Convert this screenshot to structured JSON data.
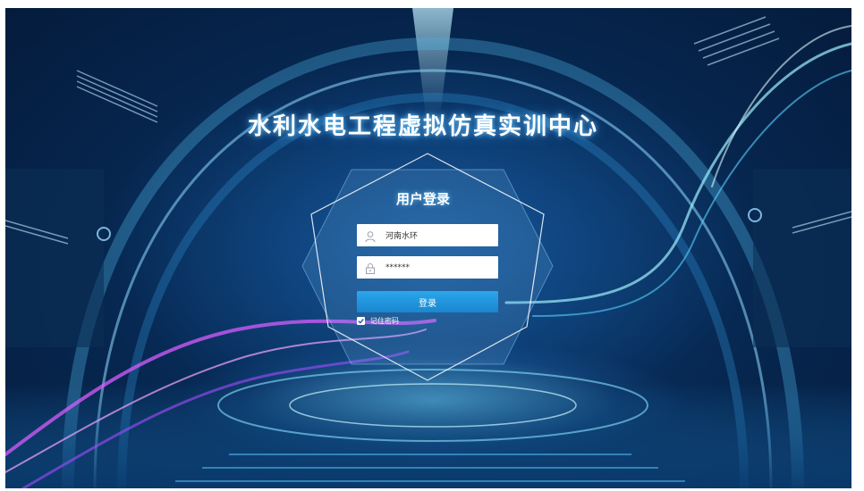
{
  "header": {
    "title": "水利水电工程虚拟仿真实训中心"
  },
  "login": {
    "title": "用户登录",
    "username_value": "河南水环",
    "password_value": "******",
    "submit_label": "登录",
    "remember_label": "记住密码",
    "remember_checked": true
  },
  "icons": {
    "username": "user-icon",
    "password": "lock-icon",
    "remember": "checkbox-check-icon"
  },
  "colors": {
    "button": "#1e95dd",
    "background": "#06254d",
    "glow": "#6fd6ff",
    "ribbon_pink": "#d75cff"
  }
}
